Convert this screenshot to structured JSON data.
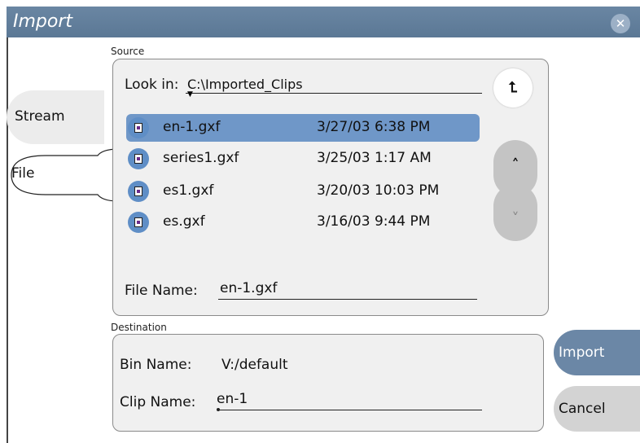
{
  "window": {
    "title": "Import"
  },
  "tabs": [
    {
      "label": "Stream",
      "selected": false
    },
    {
      "label": "File",
      "selected": true
    }
  ],
  "source": {
    "section_label": "Source",
    "look_in_label": "Look in:",
    "look_in_value": "C:\\Imported_Clips",
    "files": [
      {
        "name": "en-1.gxf",
        "date": "3/27/03 6:38 PM",
        "selected": true
      },
      {
        "name": "series1.gxf",
        "date": "3/25/03 1:17 AM",
        "selected": false
      },
      {
        "name": "es1.gxf",
        "date": "3/20/03 10:03 PM",
        "selected": false
      },
      {
        "name": "es.gxf",
        "date": "3/16/03 9:44 PM",
        "selected": false
      }
    ],
    "file_name_label": "File Name:",
    "file_name_value": "en-1.gxf"
  },
  "destination": {
    "section_label": "Destination",
    "bin_name_label": "Bin Name:",
    "bin_name_value": "V:/default",
    "clip_name_label": "Clip Name:",
    "clip_name_value": "en-1"
  },
  "buttons": {
    "import": "Import",
    "cancel": "Cancel"
  },
  "colors": {
    "titlebar": "#5b7895",
    "selection": "#6f97c8",
    "panel": "#f0f0f0",
    "import_button": "#6b87a6"
  }
}
